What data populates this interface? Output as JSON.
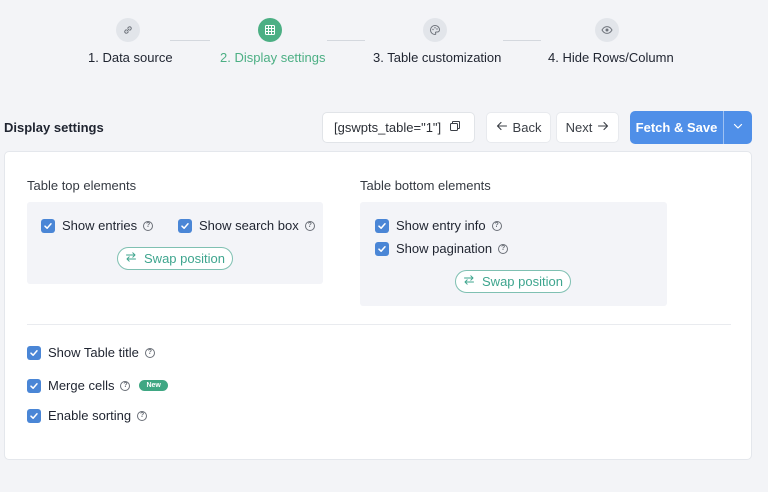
{
  "stepper": {
    "steps": [
      {
        "label": "1. Data source",
        "icon": "link-icon",
        "active": false
      },
      {
        "label": "2. Display settings",
        "icon": "grid-icon",
        "active": true
      },
      {
        "label": "3. Table customization",
        "icon": "palette-icon",
        "active": false
      },
      {
        "label": "4. Hide Rows/Column",
        "icon": "eye-icon",
        "active": false
      }
    ],
    "active_color": "#4caf84"
  },
  "header": {
    "title": "Display settings",
    "shortcode": "[gswpts_table=\"1\"]",
    "back_label": "Back",
    "next_label": "Next",
    "fetch_label": "Fetch & Save",
    "accent": "#4f8fe8"
  },
  "top_elements": {
    "title": "Table top elements",
    "options": [
      {
        "label": "Show entries",
        "checked": true
      },
      {
        "label": "Show search box",
        "checked": true
      }
    ],
    "swap_label": "Swap position"
  },
  "bottom_elements": {
    "title": "Table bottom elements",
    "options": [
      {
        "label": "Show entry info",
        "checked": true
      },
      {
        "label": "Show pagination",
        "checked": true
      }
    ],
    "swap_label": "Swap position"
  },
  "general_options": [
    {
      "label": "Show Table title",
      "checked": true
    },
    {
      "label": "Merge cells",
      "checked": true,
      "badge": "New"
    },
    {
      "label": "Enable sorting",
      "checked": true
    }
  ]
}
